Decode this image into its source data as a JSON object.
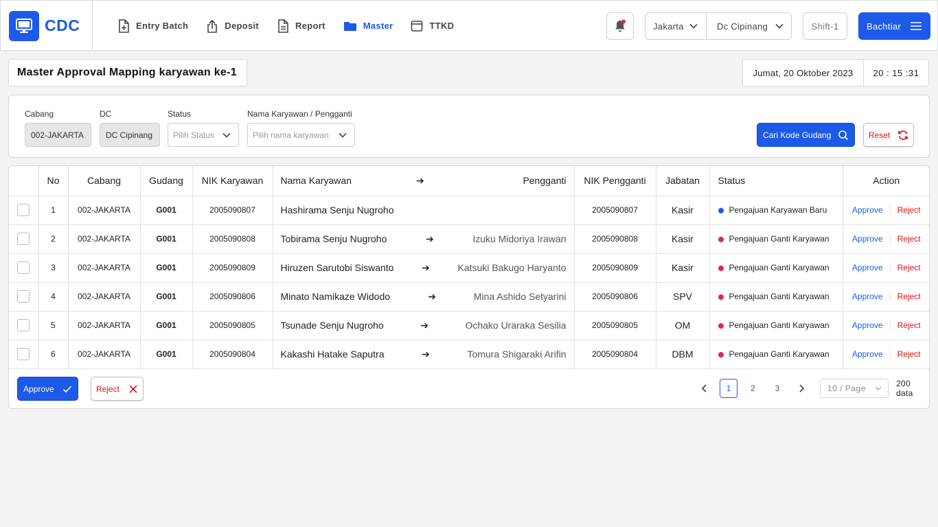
{
  "brand": {
    "name": "CDC"
  },
  "nav": [
    {
      "label": "Entry Batch",
      "icon": "file-plus-icon",
      "active": false
    },
    {
      "label": "Deposit",
      "icon": "upload-icon",
      "active": false
    },
    {
      "label": "Report",
      "icon": "document-icon",
      "active": false
    },
    {
      "label": "Master",
      "icon": "folder-icon",
      "active": true
    },
    {
      "label": "TTKD",
      "icon": "window-icon",
      "active": false
    }
  ],
  "header": {
    "city": "Jakarta",
    "dc": "Dc Cipinang",
    "shift": "Shift-1",
    "user": "Bachtiar"
  },
  "page": {
    "title": "Master Approval Mapping karyawan ke-1",
    "date": "Jumat, 20 Oktober 2023",
    "time": "20 : 15 :31"
  },
  "filters": {
    "cabang_label": "Cabang",
    "cabang_value": "002-JAKARTA",
    "dc_label": "DC",
    "dc_value": "DC Cipinang",
    "status_label": "Status",
    "status_placeholder": "Pilih Status",
    "nama_label": "Nama Karyawan / Pengganti",
    "nama_placeholder": "Pilih nama karyawan",
    "search_label": "Cari Kode Gudang",
    "reset_label": "Reset"
  },
  "table": {
    "headers": {
      "no": "No",
      "cabang": "Cabang",
      "gudang": "Gudang",
      "nik_karyawan": "NIK Karyawan",
      "nama_karyawan": "Nama Karyawan",
      "arrow": "➔",
      "pengganti": "Pengganti",
      "nik_pengganti": "NIK Pengganti",
      "jabatan": "Jabatan",
      "status": "Status",
      "action": "Action"
    },
    "rows": [
      {
        "no": "1",
        "cabang": "002-JAKARTA",
        "gudang": "G001",
        "nik": "2005090807",
        "nama": "Hashirama Senju Nugroho",
        "arrow": "",
        "pengganti": "",
        "nik_pengganti": "2005090807",
        "jabatan": "Kasir",
        "status": "Pengajuan Karyawan Baru",
        "status_color": "#1d5ae8",
        "approve": "Approve",
        "reject": "Reject"
      },
      {
        "no": "2",
        "cabang": "002-JAKARTA",
        "gudang": "G001",
        "nik": "2005090808",
        "nama": "Tobirama Senju Nugroho",
        "arrow": "➔",
        "pengganti": "Izuku Midoriya Irawan",
        "nik_pengganti": "2005090808",
        "jabatan": "Kasir",
        "status": "Pengajuan Ganti Karyawan",
        "status_color": "#e0226e",
        "approve": "Approve",
        "reject": "Reject"
      },
      {
        "no": "3",
        "cabang": "002-JAKARTA",
        "gudang": "G001",
        "nik": "2005090809",
        "nama": "Hiruzen Sarutobi Siswanto",
        "arrow": "➔",
        "pengganti": "Katsuki Bakugo Haryanto",
        "nik_pengganti": "2005090809",
        "jabatan": "Kasir",
        "status": "Pengajuan Ganti Karyawan",
        "status_color": "#e0226e",
        "approve": "Approve",
        "reject": "Reject"
      },
      {
        "no": "4",
        "cabang": "002-JAKARTA",
        "gudang": "G001",
        "nik": "2005090806",
        "nama": "Minato Namikaze Widodo",
        "arrow": "➔",
        "pengganti": "Mina Ashido Setyarini",
        "nik_pengganti": "2005090806",
        "jabatan": "SPV",
        "status": "Pengajuan Ganti Karyawan",
        "status_color": "#e0226e",
        "approve": "Approve",
        "reject": "Reject"
      },
      {
        "no": "5",
        "cabang": "002-JAKARTA",
        "gudang": "G001",
        "nik": "2005090805",
        "nama": "Tsunade Senju Nugroho",
        "arrow": "➔",
        "pengganti": "Ochako Uraraka Sesilia",
        "nik_pengganti": "2005090805",
        "jabatan": "OM",
        "status": "Pengajuan Ganti Karyawan",
        "status_color": "#e0226e",
        "approve": "Approve",
        "reject": "Reject"
      },
      {
        "no": "6",
        "cabang": "002-JAKARTA",
        "gudang": "G001",
        "nik": "2005090804",
        "nama": "Kakashi Hatake Saputra",
        "arrow": "➔",
        "pengganti": "Tomura Shigaraki Arifin",
        "nik_pengganti": "2005090804",
        "jabatan": "DBM",
        "status": "Pengajuan Ganti Karyawan",
        "status_color": "#e0226e",
        "approve": "Approve",
        "reject": "Reject"
      }
    ]
  },
  "footer": {
    "approve_label": "Approve",
    "reject_label": "Reject",
    "pages": [
      "1",
      "2",
      "3"
    ],
    "current_page": "1",
    "per_page": "10 / Page",
    "total": "200 data"
  },
  "colors": {
    "primary": "#1d5ae8",
    "danger": "#dd1111",
    "status_new": "#1d5ae8",
    "status_change": "#e0226e"
  }
}
